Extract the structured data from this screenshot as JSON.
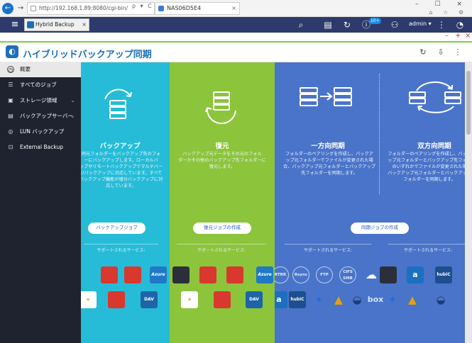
{
  "browser": {
    "address": "http://192.168.1.89:8080/cgi-bin/",
    "address_controls": "ρ ▾ C",
    "tab_title": "NAS06D5E4",
    "tab_close": "×",
    "window_controls": "– ☐ ×",
    "right_icons": "⌂ ☆ ⚙"
  },
  "topbar": {
    "menu_icon": "≡",
    "app_tab_label": "Hybrid Backup Sync...",
    "app_tab_close": "×",
    "badge": "10+",
    "user": "admin ▾",
    "icons": {
      "search": "⌕",
      "tasks": "▤",
      "sync": "↻",
      "info": "ⓘ",
      "user": "⚇",
      "more": "⋮",
      "dashboard": "◔"
    }
  },
  "subbar": {
    "minimize": "–",
    "add": "+",
    "close": "×"
  },
  "app": {
    "logo_glyph": "◐",
    "title": "ハイブリッドバックアップ同期",
    "header_icons": {
      "refresh": "↻",
      "export": "⇩",
      "more": "⋮"
    }
  },
  "sidebar": {
    "items": [
      {
        "label": "概要",
        "icon": "◷",
        "chevron": "",
        "active": true
      },
      {
        "label": "すべてのジョブ",
        "icon": "☰",
        "chevron": ""
      },
      {
        "label": "ストレージ領域",
        "icon": "▣",
        "chevron": "⌄"
      },
      {
        "label": "バックアップサーバー",
        "icon": "▤",
        "chevron": "⌄"
      },
      {
        "label": "LUN バックアップ",
        "icon": "◎",
        "chevron": ""
      },
      {
        "label": "External Backup",
        "icon": "⊡",
        "chevron": ""
      }
    ]
  },
  "panels": {
    "backup": {
      "title": "バックアップ",
      "desc": "同元フォルダーをバックアップ先のフォ\nーにバックアップします。ローカルバ\nップやリモートバックアップでマルチバー\nジバックアップに対応しています。すべて\nバックアップ機能が増分バックアップに対\n応しています。",
      "button": "バックアップジョブ",
      "support": "サポートされるサービス:"
    },
    "restore": {
      "title": "復元",
      "desc": "バックアップ元データをその元のフォル\nダーかその他のバックアップ先フォルダーに\n復元します。",
      "button": "復元ジョブの作成",
      "support": "サポートされるサービス:"
    },
    "oneway": {
      "title": "一方向同期",
      "desc": "フォルダーのペアリングを作成し、バックア\nップ元フォルダーでファイルが変更された場\n合、バックアップ元フォルダーとバックアップ\n先フォルダーを同期します。",
      "button": "同期ジョブの作成",
      "support": "サポートされるサービス:"
    },
    "twoway": {
      "title": "双方向同期",
      "desc": "フォルダーのペアリングを作成し、バック\nップ元フォルダーとバックアップ先フォル\nのいずれかでファイルが変更された場\nバックアップ元フォルダーとバックアップ\nフォルダーを同期します。",
      "support": "サポートされるサービス:"
    }
  },
  "logos": {
    "azure": "Azure",
    "dav": "DAV",
    "rsync": "Rsync",
    "ftp": "FTP",
    "rtrr": "RTRR",
    "cifs": "CIFS\nSMB",
    "hubic": "hubiC",
    "box": "box",
    "a": "a"
  },
  "colors": {
    "backup": "#26bcd7",
    "restore": "#8cc43c",
    "sync": "#4a74c9",
    "sidebar": "#1f2330",
    "topbar": "#2d3a6b"
  }
}
